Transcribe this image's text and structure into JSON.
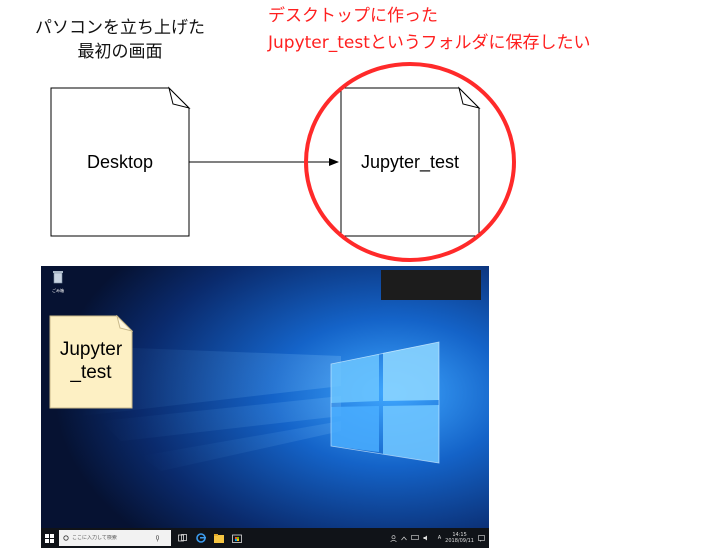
{
  "captions": {
    "left": [
      "パソコンを立ち上げた",
      "最初の画面"
    ],
    "right": [
      "デスクトップに作った",
      "Jupyter_testというフォルダに保存したい"
    ]
  },
  "diagram": {
    "source_node": "Desktop",
    "target_node": "Jupyter_test"
  },
  "colors": {
    "highlight": "#ff2a2a",
    "note_fill": "#fdf0c4",
    "taskbar": "#101318"
  },
  "screenshot": {
    "recycle_bin_label": "ごみ箱",
    "note_label": [
      "Jupyter",
      "_test"
    ],
    "taskbar": {
      "search_placeholder": "ここに入力して検索",
      "ime_label": "A",
      "clock_time": "14:15",
      "clock_date": "2018/09/11"
    },
    "icons": [
      "windows-start-icon",
      "search-icon",
      "mic-icon",
      "task-view-icon",
      "edge-icon",
      "file-explorer-icon",
      "store-icon"
    ]
  }
}
